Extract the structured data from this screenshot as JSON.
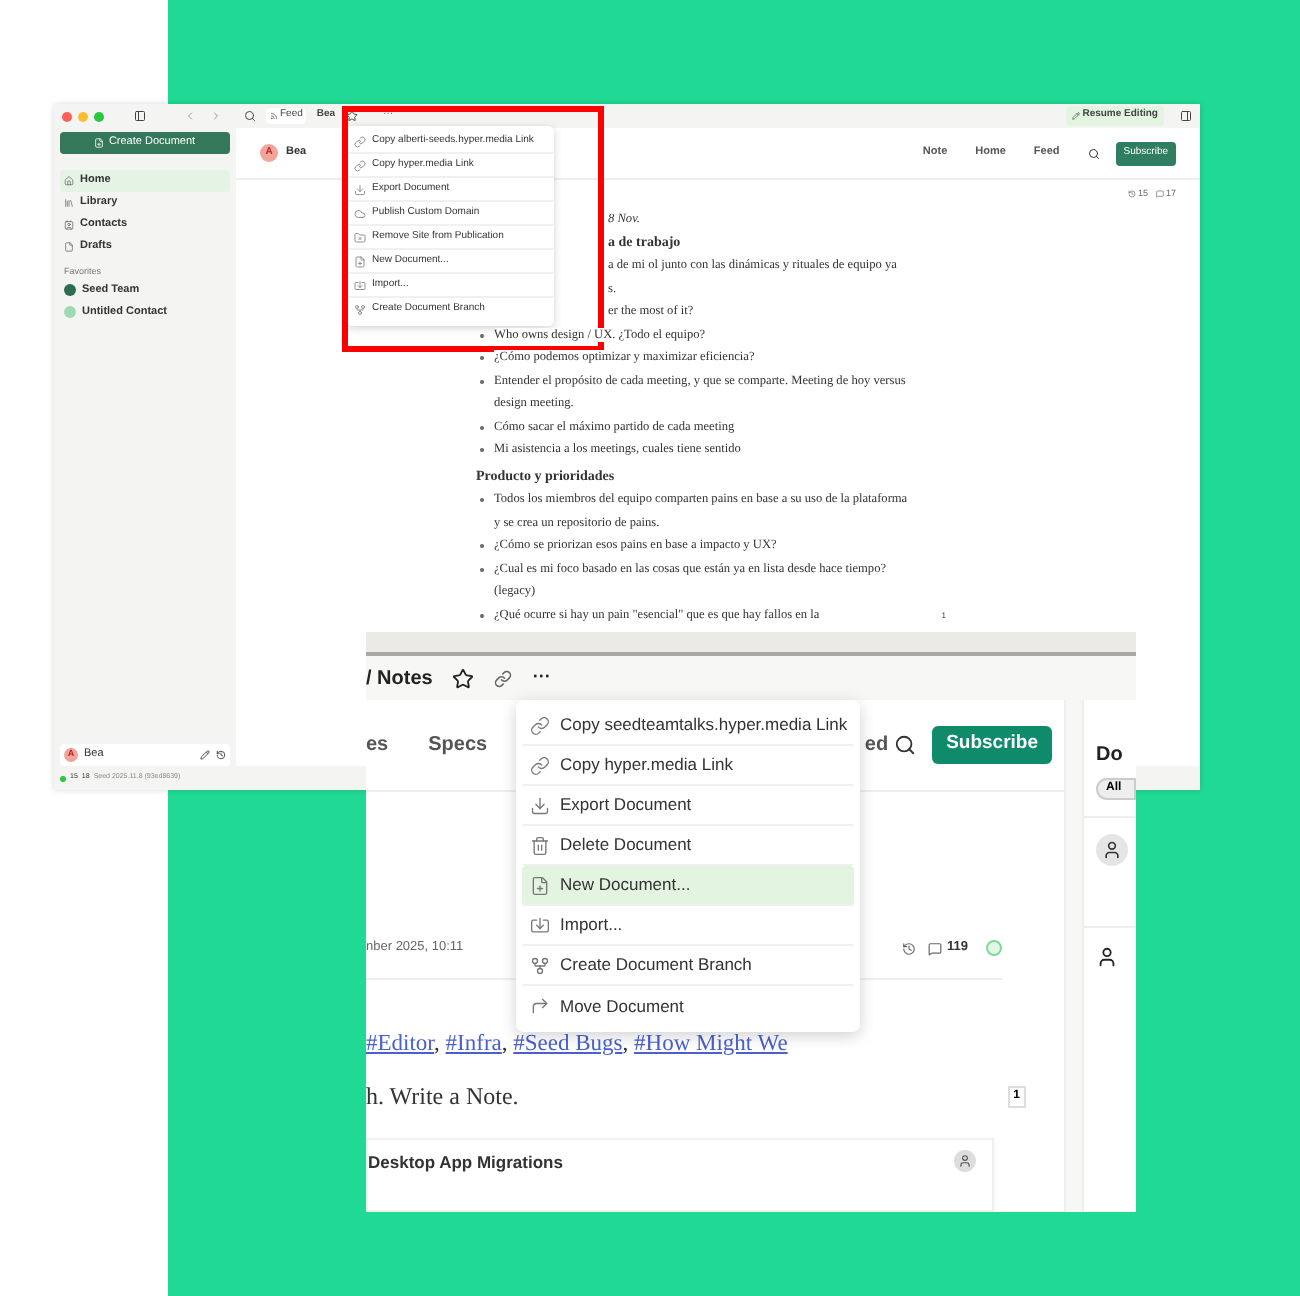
{
  "desktop_window": {
    "toolbar": {
      "feed": "Feed",
      "document": "Bea",
      "more": "···",
      "resume_button": "Resume Editing"
    },
    "sidebar": {
      "create_button": "Create Document",
      "items": [
        {
          "label": "Home",
          "kind": "home",
          "selected": true
        },
        {
          "label": "Library",
          "kind": "library",
          "selected": false
        },
        {
          "label": "Contacts",
          "kind": "contacts",
          "selected": false
        },
        {
          "label": "Drafts",
          "kind": "drafts",
          "selected": false
        }
      ],
      "favorites_heading": "Favorites",
      "favorites": [
        {
          "label": "Seed Team",
          "color": "#2f6b4f"
        },
        {
          "label": "Untitled Contact",
          "color": "#9edbb3"
        }
      ],
      "account": {
        "avatar": "A",
        "name": "Bea"
      },
      "status": {
        "count_1": "15",
        "count_2": "18",
        "version": "Seed 2025.11.8 (93ed8639)"
      }
    },
    "site_header": {
      "avatar": "A",
      "name": "Bea",
      "nav": [
        "Note",
        "Home",
        "Feed"
      ],
      "subscribe": "Subscribe"
    },
    "counts": {
      "versions": "15",
      "comments": "17"
    },
    "document": [
      {
        "kind": "fragment",
        "text": "8 Nov.",
        "italic": true
      },
      {
        "kind": "fragment-heading",
        "text": "a de trabajo"
      },
      {
        "kind": "fragment",
        "text": "a de mi ol junto con las dinámicas y rituales de equipo ya"
      },
      {
        "kind": "fragment",
        "text": "s."
      },
      {
        "kind": "fragment",
        "text": "er the most of it?"
      },
      {
        "kind": "bullet",
        "text": "Who owns design / UX. ¿Todo el equipo?"
      },
      {
        "kind": "bullet",
        "text": "¿Cómo podemos optimizar y maximizar eficiencia?"
      },
      {
        "kind": "bullet",
        "text": "Entender el propósito de cada meeting, y que se comparte. Meeting de hoy versus design meeting."
      },
      {
        "kind": "bullet",
        "text": "Cómo sacar el máximo partido de cada meeting"
      },
      {
        "kind": "bullet",
        "text": "Mi asistencia a los meetings, cuales tiene sentido"
      },
      {
        "kind": "heading",
        "text": "Producto y prioridades"
      },
      {
        "kind": "bullet",
        "text": "Todos los miembros del equipo comparten pains en base a su uso de la plataforma y se crea un repositorio de pains."
      },
      {
        "kind": "bullet",
        "text": "¿Cómo se priorizan esos pains en base a impacto y UX?"
      },
      {
        "kind": "bullet",
        "text": "¿Cual es mi foco basado en las cosas que están ya en lista desde hace tiempo? (legacy)"
      },
      {
        "kind": "bullet",
        "text": "¿Qué ocurre si hay un pain \"esencial\" que es que hay fallos en la",
        "footnote": "1"
      }
    ],
    "menu": [
      {
        "label": "Copy alberti-seeds.hyper.media Link",
        "kind": "link",
        "selected": false
      },
      {
        "label": "Copy hyper.media Link",
        "kind": "link",
        "selected": false
      },
      {
        "label": "Export Document",
        "kind": "export",
        "selected": false
      },
      {
        "label": "Publish Custom Domain",
        "kind": "publish",
        "selected": false
      },
      {
        "label": "Remove Site from Publication",
        "kind": "remove-site",
        "selected": false
      },
      {
        "label": "New Document...",
        "kind": "new-document",
        "selected": false
      },
      {
        "label": "Import...",
        "kind": "import",
        "selected": false
      },
      {
        "label": "Create Document Branch",
        "kind": "branch",
        "selected": false
      }
    ]
  },
  "web_window": {
    "breadcrumb": "/ Notes",
    "more": "···",
    "nav": [
      "es",
      "Specs",
      "ed"
    ],
    "subscribe": "Subscribe",
    "meta": {
      "date": "nber 2025, 10:11",
      "comments": "119"
    },
    "tags": [
      "#Editor",
      "#Infra",
      "#Seed Bugs",
      "#How Might We"
    ],
    "tag_separator": ",",
    "note": "h. Write a Note.",
    "footnote": "1",
    "card_title": "Desktop App Migrations",
    "side_panel": {
      "heading": "Do",
      "chip": "All"
    },
    "menu": [
      {
        "label": "Copy seedteamtalks.hyper.media Link",
        "kind": "link",
        "selected": false
      },
      {
        "label": "Copy hyper.media Link",
        "kind": "link",
        "selected": false
      },
      {
        "label": "Export Document",
        "kind": "export",
        "selected": false
      },
      {
        "label": "Delete Document",
        "kind": "delete",
        "selected": false
      },
      {
        "label": "New Document...",
        "kind": "new-document",
        "selected": true
      },
      {
        "label": "Import...",
        "kind": "import",
        "selected": false
      },
      {
        "label": "Create Document Branch",
        "kind": "branch",
        "selected": false
      },
      {
        "label": "Move Document",
        "kind": "move",
        "selected": false
      }
    ]
  }
}
